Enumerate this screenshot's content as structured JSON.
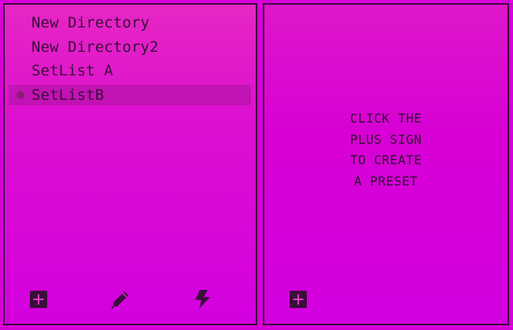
{
  "directories": {
    "items": [
      {
        "label": "New Directory",
        "selected": false
      },
      {
        "label": "New Directory2",
        "selected": false
      },
      {
        "label": "SetList A",
        "selected": false
      },
      {
        "label": "SetListB",
        "selected": true
      }
    ]
  },
  "left_toolbar": {
    "icons": [
      "plus-square-icon",
      "pencil-icon",
      "lightning-bolt-icon"
    ]
  },
  "presets": {
    "hint_lines": [
      "CLICK THE",
      "PLUS SIGN",
      "TO CREATE",
      "A PRESET"
    ]
  },
  "right_toolbar": {
    "icons": [
      "plus-square-icon"
    ]
  },
  "colors": {
    "background_top": "#e627c4",
    "background_bottom": "#d300df",
    "border": "#3d0a3d",
    "text": "#3a0f3a",
    "selection_bullet": "#8a1f74"
  }
}
